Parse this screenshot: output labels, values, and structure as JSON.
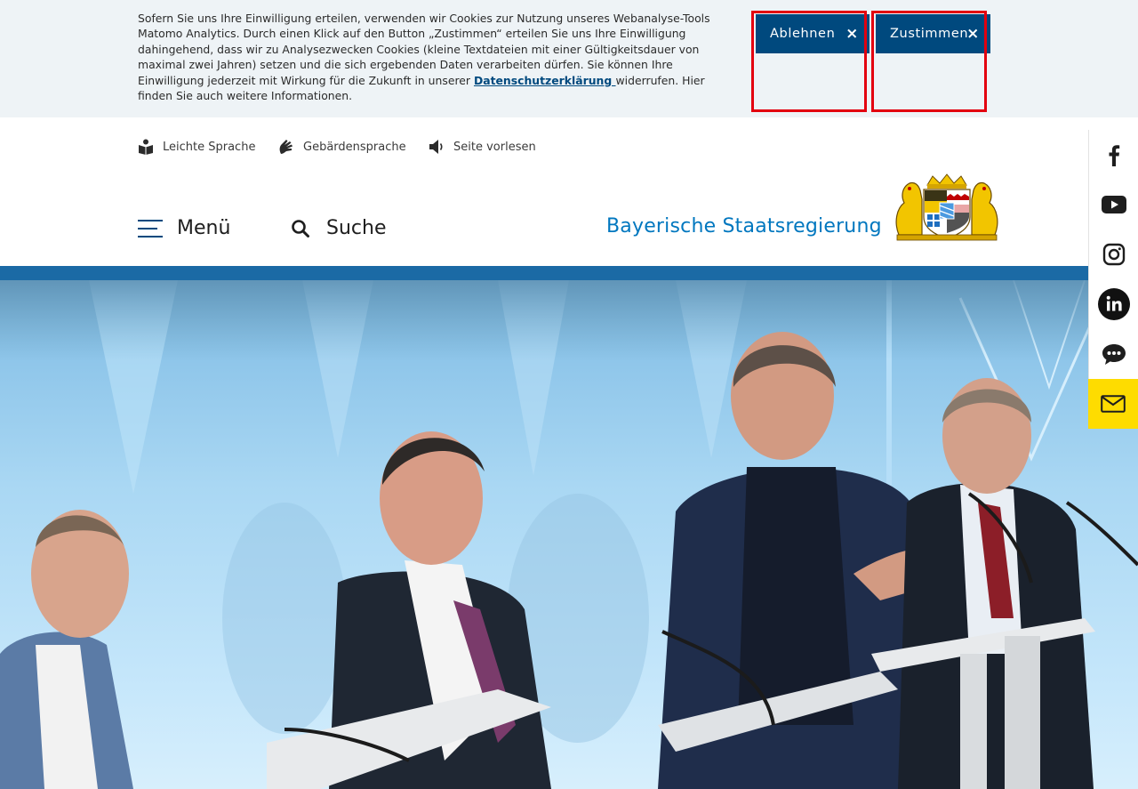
{
  "cookie_banner": {
    "text_before_link": "Sofern Sie uns Ihre Einwilligung erteilen, verwenden wir Cookies zur Nutzung unseres Webanalyse-Tools Matomo Analytics. Durch einen Klick auf den Button „Zustimmen“ erteilen Sie uns Ihre Einwilligung dahingehend, dass wir zu Analysezwecken Cookies (kleine Textdateien mit einer Gültigkeitsdauer von maximal zwei Jahren) setzen und die sich ergebenden Daten verarbeiten dürfen. Sie können Ihre Einwilligung jederzeit mit Wirkung für die Zukunft in unserer ",
    "privacy_link": "Datenschutzerklärung ",
    "text_after_link": "widerrufen. Hier finden Sie auch weitere Informationen.",
    "decline_label": "Ablehnen",
    "accept_label": "Zustimmen",
    "close_glyph": "×"
  },
  "accessibility": {
    "easy_language": "Leichte Sprache",
    "sign_language": "Gebärdensprache",
    "read_aloud": "Seite vorlesen"
  },
  "header": {
    "menu_label": "Menü",
    "search_label": "Suche",
    "brand_name": "Bayerische Staatsregierung"
  },
  "social_icons": [
    "facebook-icon",
    "youtube-icon",
    "instagram-icon",
    "linkedin-icon",
    "chat-icon",
    "mail-icon"
  ],
  "colors": {
    "primary_blue": "#00497e",
    "brand_blue": "#0077bf",
    "focus_red": "#e3000f",
    "mail_yellow": "#fedc00",
    "banner_bg": "#eef3f6"
  }
}
